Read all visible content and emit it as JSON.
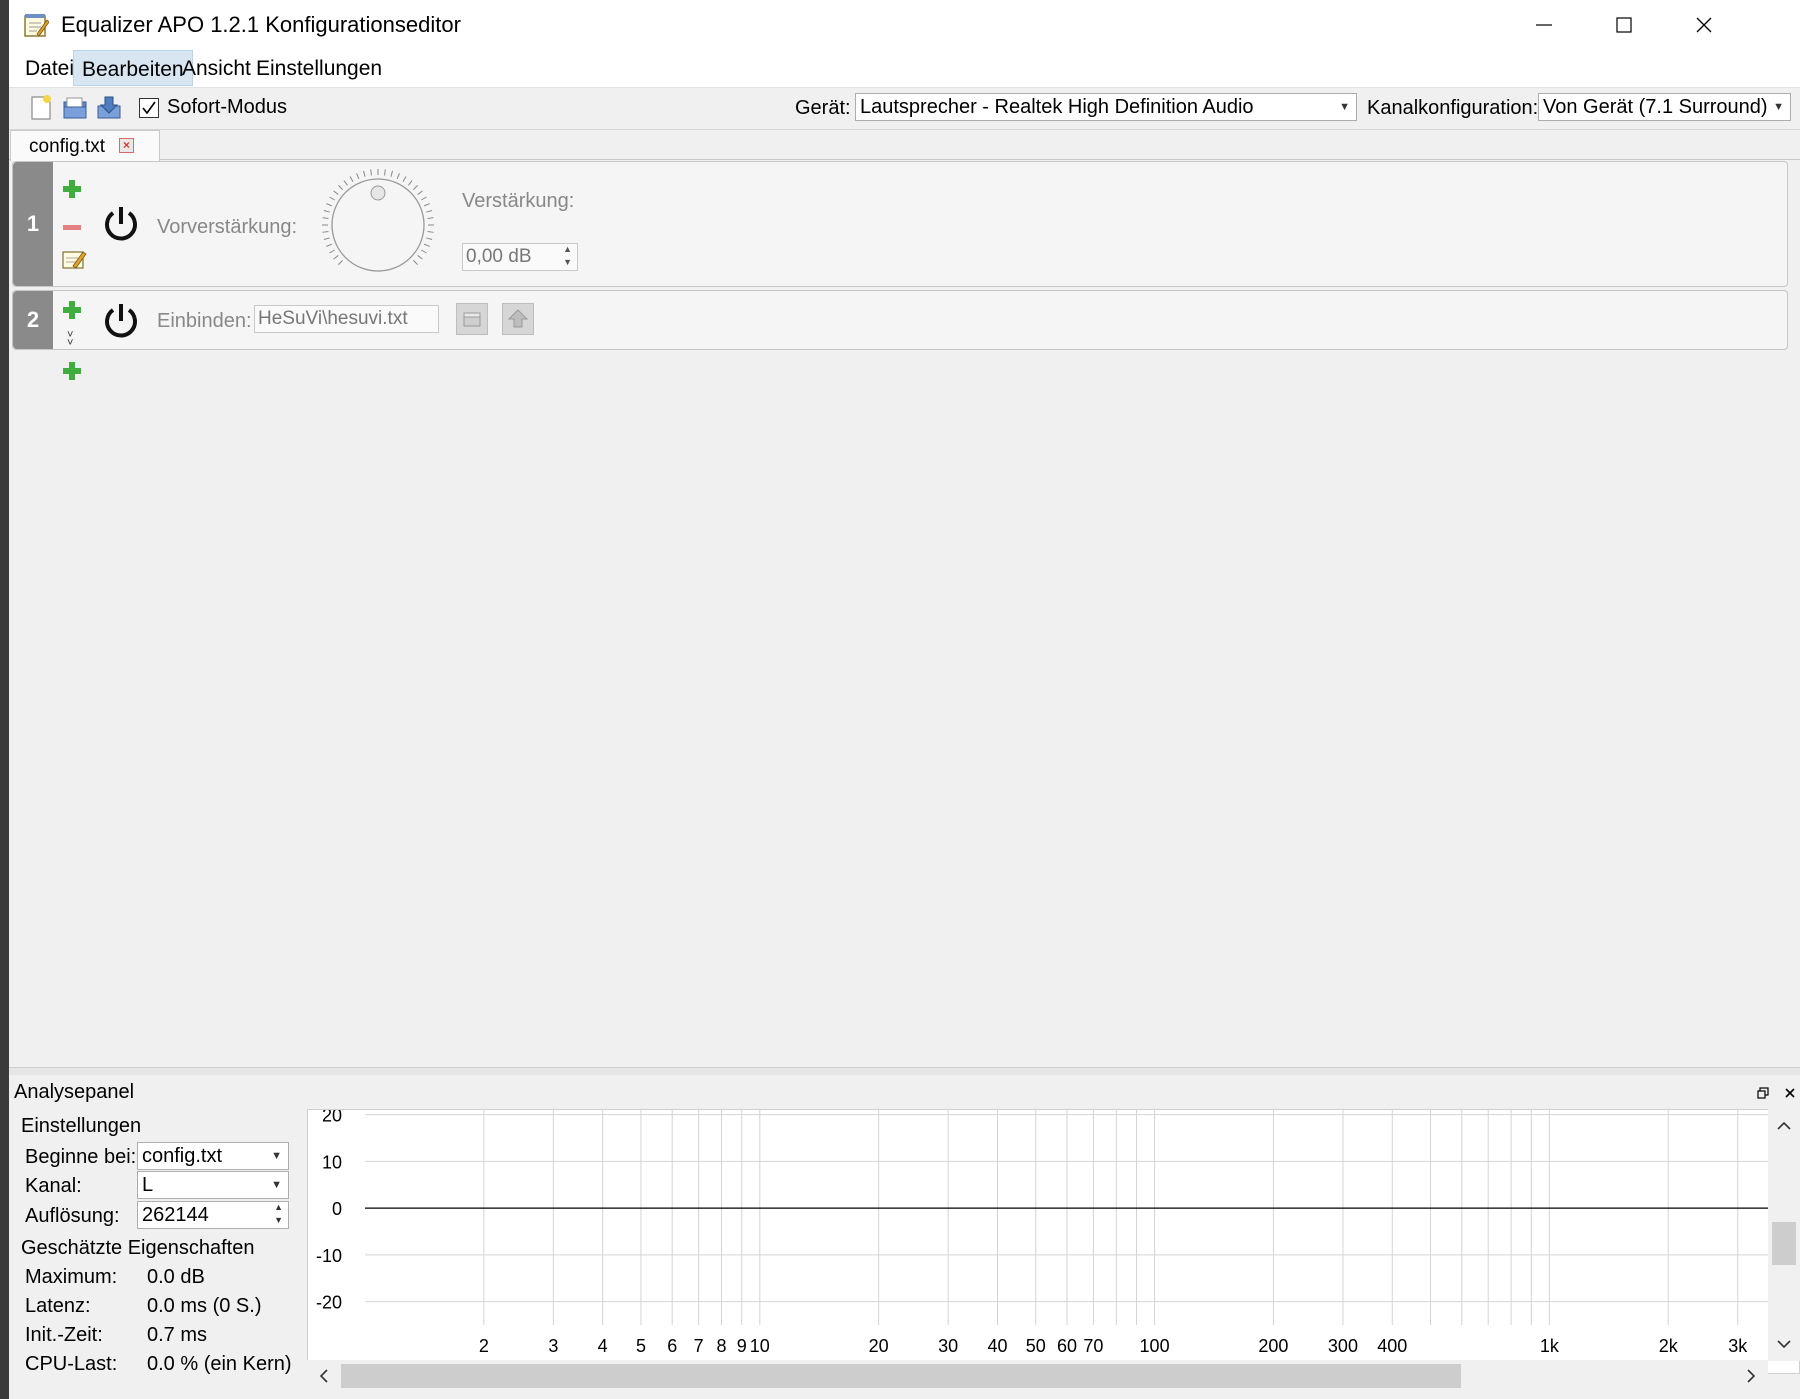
{
  "window": {
    "title": "Equalizer APO 1.2.1 Konfigurationseditor"
  },
  "menu": [
    {
      "label": "Datei",
      "active": false
    },
    {
      "label": "Bearbeiten",
      "active": true
    },
    {
      "label": "Ansicht",
      "active": false
    },
    {
      "label": "Einstellungen",
      "active": false
    }
  ],
  "toolbar": {
    "instant_mode_label": "Sofort-Modus",
    "instant_mode_checked": true,
    "device_label": "Gerät:",
    "device_value": "Lautsprecher - Realtek High Definition Audio",
    "channel_config_label": "Kanalkonfiguration:",
    "channel_config_value": "Von Gerät (7.1 Surround)"
  },
  "tabs": [
    {
      "label": "config.txt"
    }
  ],
  "filters": [
    {
      "number": "1",
      "preamp_label": "Vorverstärkung:",
      "gain_label": "Verstärkung:",
      "gain_value": "0,00 dB"
    },
    {
      "number": "2",
      "include_label": "Einbinden:",
      "include_value": "HeSuVi\\hesuvi.txt"
    }
  ],
  "analysis": {
    "title": "Analysepanel",
    "settings_group": "Einstellungen",
    "start_label": "Beginne bei:",
    "start_value": "config.txt",
    "channel_label": "Kanal:",
    "channel_value": "L",
    "resolution_label": "Auflösung:",
    "resolution_value": "262144",
    "props_group": "Geschätzte Eigenschaften",
    "props": [
      {
        "label": "Maximum:",
        "value": "0.0 dB"
      },
      {
        "label": "Latenz:",
        "value": "0.0 ms (0 S.)"
      },
      {
        "label": "Init.-Zeit:",
        "value": "0.7 ms"
      },
      {
        "label": "CPU-Last:",
        "value": "0.0 % (ein Kern)"
      }
    ]
  },
  "chart_data": {
    "type": "line",
    "xscale": "log",
    "xlim": [
      1,
      3600
    ],
    "ylim": [
      -25,
      21
    ],
    "x_ticks": [
      2,
      3,
      4,
      5,
      6,
      7,
      8,
      9,
      10,
      20,
      30,
      40,
      50,
      60,
      70,
      100,
      200,
      300,
      400,
      1000,
      2000,
      3000
    ],
    "x_tick_labels": [
      "2",
      "3",
      "4",
      "5",
      "6",
      "7",
      "8",
      "9",
      "10",
      "20",
      "30",
      "40",
      "50",
      "60",
      "70",
      "100",
      "200",
      "300",
      "400",
      "1k",
      "2k",
      "3k"
    ],
    "x_gridlines": [
      2,
      3,
      4,
      5,
      6,
      7,
      8,
      9,
      10,
      20,
      30,
      40,
      50,
      60,
      70,
      80,
      90,
      100,
      200,
      300,
      400,
      500,
      600,
      700,
      800,
      900,
      1000,
      2000,
      3000
    ],
    "y_ticks": [
      20,
      10,
      0,
      -10,
      -20
    ],
    "y_tick_labels": [
      "20",
      "10",
      "0",
      "-10",
      "-20"
    ],
    "grid": true,
    "series": [
      {
        "x": [
          1,
          3600
        ],
        "y": [
          0,
          0
        ]
      }
    ]
  }
}
